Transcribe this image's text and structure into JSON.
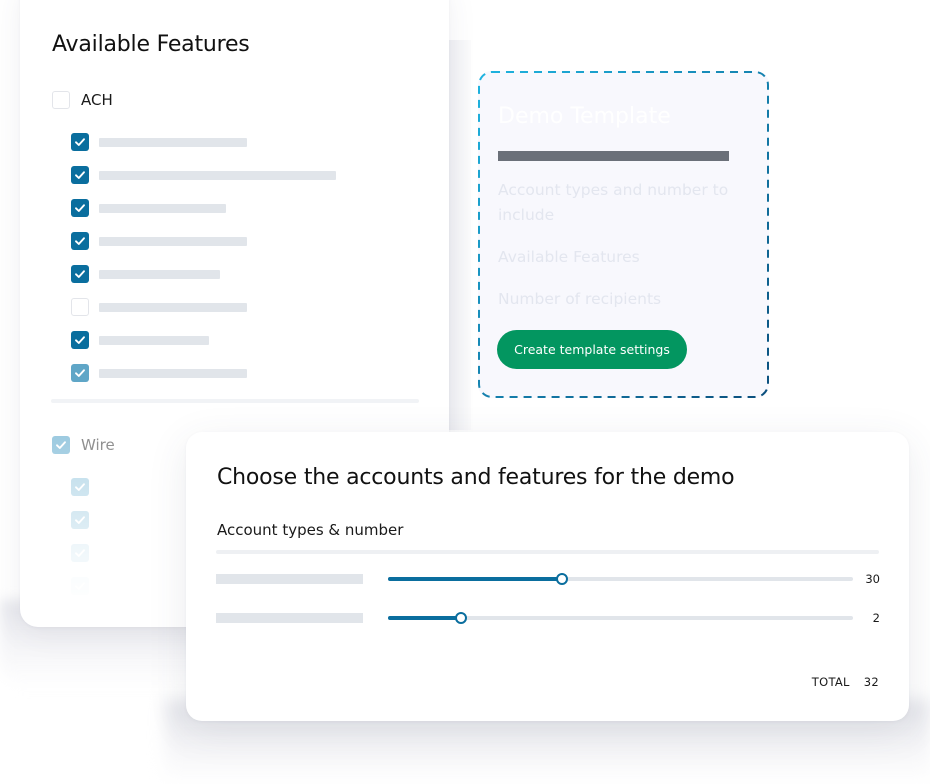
{
  "available_features": {
    "title": "Available Features",
    "groups": [
      {
        "label": "ACH",
        "checked": false,
        "items": [
          {
            "checked": true,
            "state": "on",
            "placeholder_fraction": 0.5
          },
          {
            "checked": true,
            "state": "on",
            "placeholder_fraction": 0.8
          },
          {
            "checked": true,
            "state": "on",
            "placeholder_fraction": 0.43
          },
          {
            "checked": true,
            "state": "on",
            "placeholder_fraction": 0.5
          },
          {
            "checked": true,
            "state": "on",
            "placeholder_fraction": 0.41
          },
          {
            "checked": false,
            "state": "off",
            "placeholder_fraction": 0.5
          },
          {
            "checked": true,
            "state": "on",
            "placeholder_fraction": 0.37
          },
          {
            "checked": true,
            "state": "soft",
            "placeholder_fraction": 0.5
          }
        ]
      },
      {
        "label": "Wire",
        "checked": true,
        "items": [
          {
            "checked": true,
            "state": "faint2"
          },
          {
            "checked": true,
            "state": "faint2"
          },
          {
            "checked": true,
            "state": "faint3"
          },
          {
            "checked": true,
            "state": "faint4"
          }
        ]
      }
    ]
  },
  "demo_template": {
    "title": "Demo Template",
    "fields": [
      "Account types and number to include",
      "Available Features",
      "Number of recipients"
    ],
    "button_label": "Create template settings",
    "colors": {
      "button": "#039660",
      "border_start": "#1fb4e0",
      "border_end": "#0b4f7d"
    }
  },
  "account_selection": {
    "title": "Choose the accounts and features for the demo",
    "section_label": "Account types & number",
    "rows": [
      {
        "value": "30",
        "slider_fraction": 0.374
      },
      {
        "value": "2",
        "slider_fraction": 0.157
      }
    ],
    "total_label": "TOTAL",
    "total_value": "32",
    "accent_color": "#0a6e9e"
  }
}
